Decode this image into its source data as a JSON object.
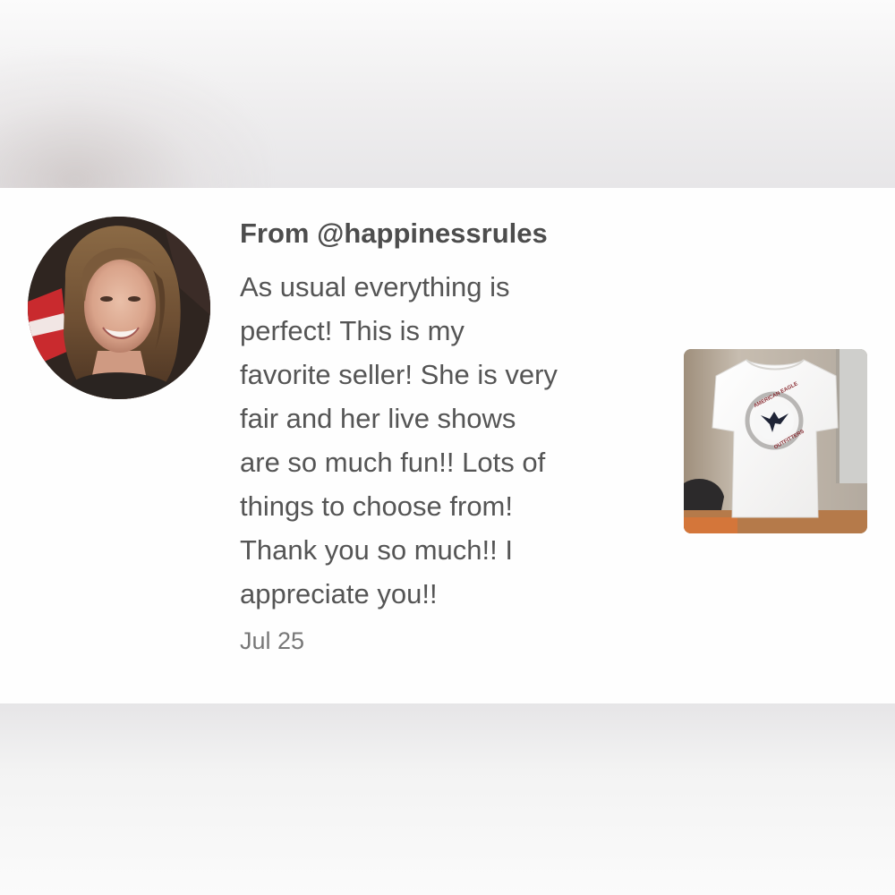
{
  "review": {
    "from_prefix": "From",
    "username": "@happinessrules",
    "from_line": "From @happinessrules",
    "text": "As usual everything is\nperfect! This is my\nfavorite seller! She is very\nfair and her live shows\nare so much fun!! Lots of\nthings to choose from!\nThank you so much!! I\nappreciate you!!",
    "date": "Jul 25"
  },
  "avatar": {
    "icon": "user-avatar-photo"
  },
  "product_thumbnail": {
    "icon": "white-tshirt-photo",
    "logo_top_text": "AMERICAN EAGLE",
    "logo_bottom_text": "OUTFITTERS"
  },
  "colors": {
    "card_background": "#fefefe",
    "page_background": "#f4f3f4",
    "username_text": "#4d4d4d",
    "body_text": "#555555",
    "date_text": "#777777"
  }
}
